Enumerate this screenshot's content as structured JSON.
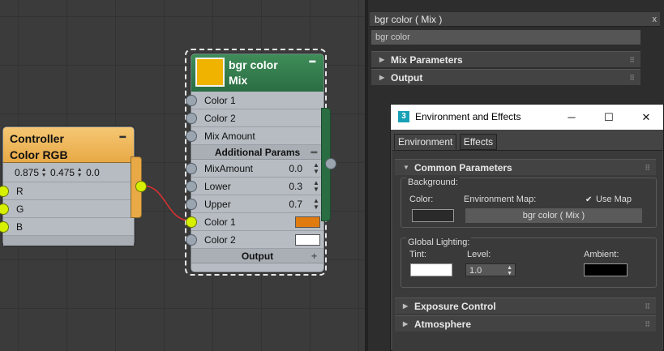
{
  "colors": {
    "canvas_bg": "#3b3b3b",
    "controller_header": "#e8a946",
    "mix_header": "#2a6d42",
    "mix_swatch": "#f0b400",
    "wire": "#e03030",
    "live_socket": "#d6f000",
    "color1_swatch": "#e07b10",
    "color2_swatch": "#ffffff",
    "tint_swatch": "#ffffff",
    "ambient_swatch": "#000000",
    "env_color_swatch": "#2a2a2a"
  },
  "controller_node": {
    "title_line1": "Controller",
    "title_line2": "Color RGB",
    "minimize": "━",
    "values": [
      "0.875",
      "0.475",
      "0.0"
    ],
    "rows": [
      "R",
      "G",
      "B"
    ]
  },
  "mix_node": {
    "title_line1": "bgr color",
    "title_line2": "Mix",
    "minimize": "━",
    "inputs": [
      "Color 1",
      "Color 2",
      "Mix Amount"
    ],
    "section_label": "Additional Params",
    "section_toggle": "━",
    "params": [
      {
        "label": "MixAmount",
        "value": "0.0"
      },
      {
        "label": "Lower",
        "value": "0.3"
      },
      {
        "label": "Upper",
        "value": "0.7"
      }
    ],
    "color_rows": [
      "Color 1",
      "Color 2"
    ],
    "output_label": "Output",
    "output_toggle": "+"
  },
  "parameter_panel": {
    "title": "bgr color  ( Mix )",
    "close": "x",
    "name_field": "bgr color",
    "rollouts": [
      "Mix Parameters",
      "Output"
    ]
  },
  "env_dialog": {
    "title": "Environment and Effects",
    "app_icon": "3",
    "tabs": [
      "Environment",
      "Effects"
    ],
    "active_tab": "Environment",
    "common_params": "Common Parameters",
    "background_label": "Background:",
    "color_label": "Color:",
    "env_map_label": "Environment Map:",
    "use_map_label": "Use Map",
    "use_map_checked": true,
    "env_map_button": "bgr color  ( Mix )",
    "global_lighting_label": "Global Lighting:",
    "tint_label": "Tint:",
    "level_label": "Level:",
    "level_value": "1.0",
    "ambient_label": "Ambient:",
    "rollouts": [
      "Exposure Control",
      "Atmosphere"
    ]
  }
}
